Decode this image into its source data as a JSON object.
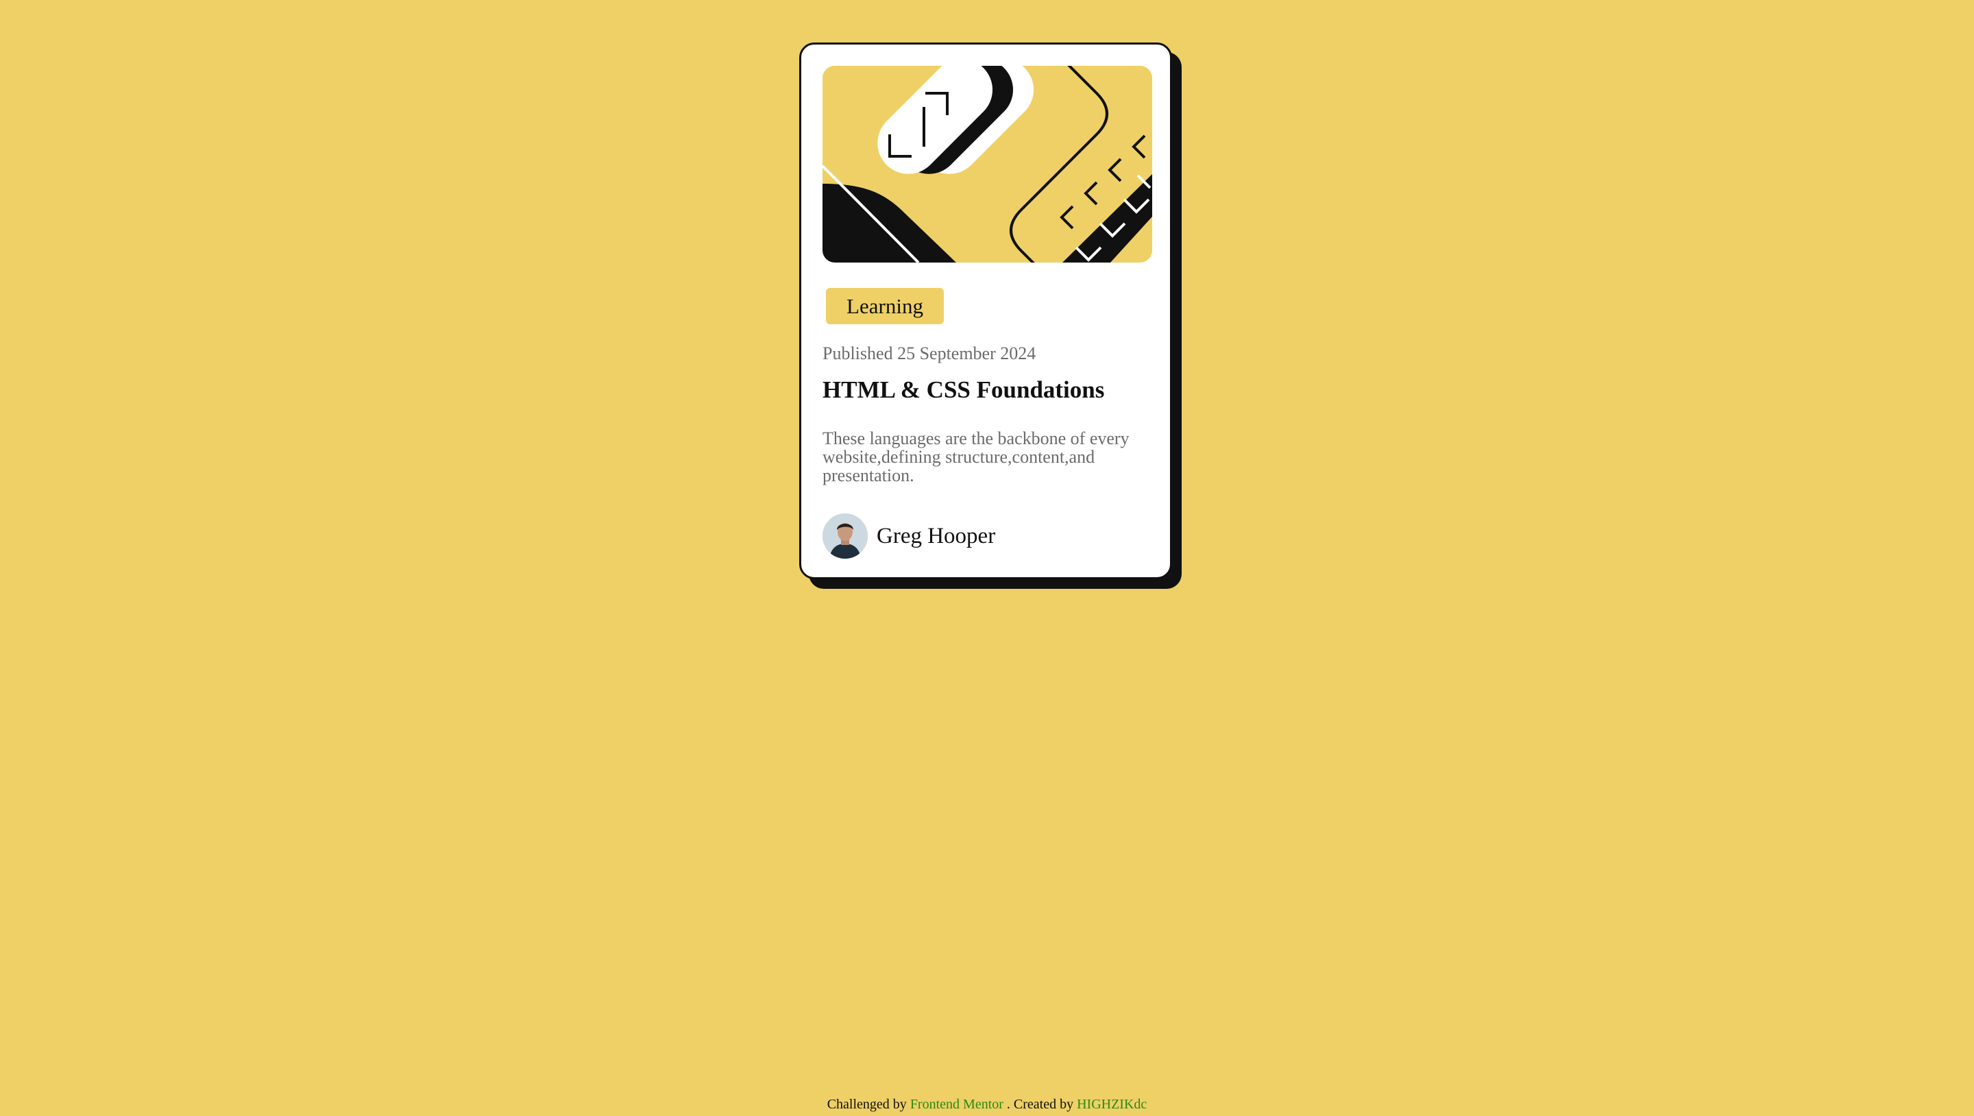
{
  "card": {
    "category_tag": "Learning",
    "published": "Published 25 September 2024",
    "title": "HTML & CSS Foundations",
    "description": "These languages are the backbone of every website,defining structure,content,and presentation.",
    "author": {
      "name": "Greg Hooper"
    }
  },
  "attribution": {
    "prefix": "Challenged by",
    "challenge_link": "Frontend Mentor",
    "middle": ". Created by",
    "author_link": "HIGHZIKdc"
  },
  "colors": {
    "background": "#eed066",
    "card": "#ffffff",
    "ink": "#111111",
    "muted_text": "#6b6b6b",
    "link": "#2a8a13"
  },
  "icons": {
    "hero": "abstract-illustration",
    "avatar": "author-avatar"
  }
}
